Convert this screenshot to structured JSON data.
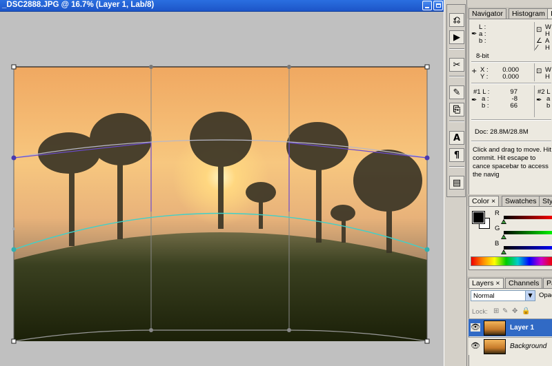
{
  "document": {
    "title": "_DSC2888.JPG @ 16.7% (Layer 1, Lab/8)"
  },
  "info_panel": {
    "tabs": [
      "Navigator",
      "Histogram",
      "I"
    ],
    "lab_labels": [
      "L :",
      "a :",
      "b :"
    ],
    "wh_labels": [
      "W",
      "H"
    ],
    "angle_labels": [
      "A",
      "H"
    ],
    "bit_depth": "8-bit",
    "x_label": "X :",
    "y_label": "Y :",
    "x_value": "0.000",
    "y_value": "0.000",
    "wh2_labels": [
      "W",
      "H"
    ],
    "sample1": {
      "L_label": "#1 L :",
      "a_label": "a :",
      "b_label": "b :",
      "L": "97",
      "a": "-8",
      "b": "66"
    },
    "sample2": {
      "L_label": "#2 L",
      "a_label": "a",
      "b_label": "b"
    },
    "doc_size": "Doc: 28.8M/28.8M",
    "status": "Click and drag to move. Hit commit. Hit escape to cance spacebar to access the navig"
  },
  "color_panel": {
    "tabs": [
      "Color ×",
      "Swatches",
      "Sty"
    ],
    "channels": [
      {
        "label": "R",
        "value": 0,
        "color": "#d02020"
      },
      {
        "label": "G",
        "value": 0,
        "color": "#20a020"
      },
      {
        "label": "B",
        "value": 0,
        "color": "#2040d0"
      }
    ],
    "foreground": "#000000",
    "background": "#ffffff"
  },
  "layers_panel": {
    "tabs": [
      "Layers ×",
      "Channels",
      "Pa"
    ],
    "blend_mode": "Normal",
    "opacity_label": "Opac",
    "lock_label": "Lock:",
    "layers": [
      {
        "name": "Layer 1",
        "selected": true
      },
      {
        "name": "Background",
        "selected": false
      }
    ]
  },
  "toolbar": {
    "icons": [
      "history-icon",
      "actions-icon",
      "tool-presets-icon",
      "brushes-icon",
      "clone-source-icon",
      "character-icon",
      "paragraph-icon",
      "layer-comps-icon"
    ],
    "character_glyph": "A",
    "paragraph_glyph": "¶"
  }
}
